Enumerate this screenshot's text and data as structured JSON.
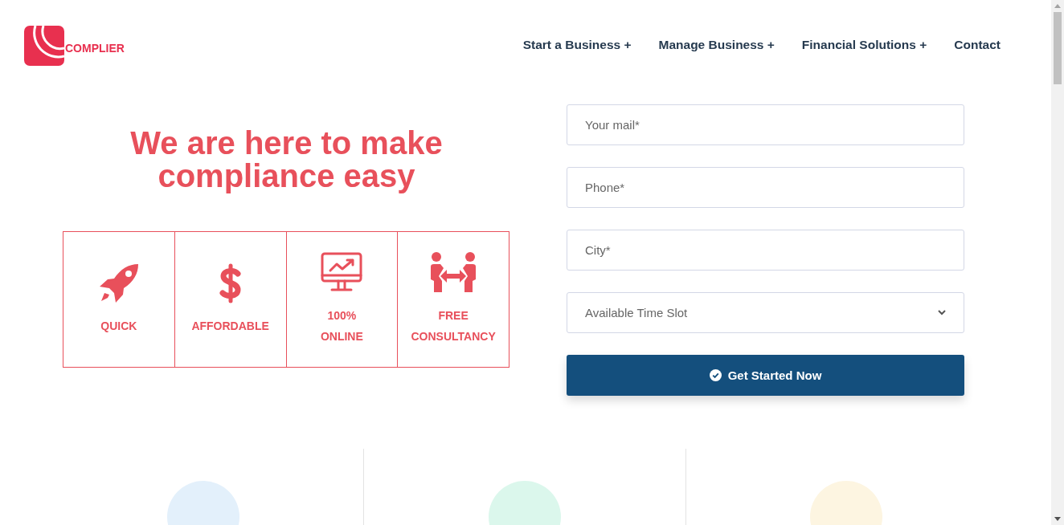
{
  "logo": {
    "text": "COMPLIER"
  },
  "nav": [
    {
      "label": "Start a Business +"
    },
    {
      "label": "Manage Business +"
    },
    {
      "label": "Financial Solutions +"
    },
    {
      "label": "Contact"
    }
  ],
  "hero": {
    "heading": "We are here to make compliance easy"
  },
  "features": [
    {
      "kind": "rocket",
      "lines": [
        "QUICK"
      ]
    },
    {
      "kind": "dollar",
      "lines": [
        "AFFORDABLE"
      ]
    },
    {
      "kind": "monitor",
      "lines": [
        "100%",
        "ONLINE"
      ]
    },
    {
      "kind": "people",
      "lines": [
        "FREE",
        "CONSULTANCY"
      ]
    }
  ],
  "form": {
    "fields": [
      {
        "kind": "input",
        "placeholder": "Your mail*"
      },
      {
        "kind": "input",
        "placeholder": "Phone*"
      },
      {
        "kind": "input",
        "placeholder": "City*"
      },
      {
        "kind": "select",
        "placeholder": "Available Time Slot"
      }
    ],
    "button": "Get Started Now"
  },
  "services": [
    {
      "color": "#e3f0fb"
    },
    {
      "color": "#dbf7ec"
    },
    {
      "color": "#fdf5e1"
    }
  ]
}
